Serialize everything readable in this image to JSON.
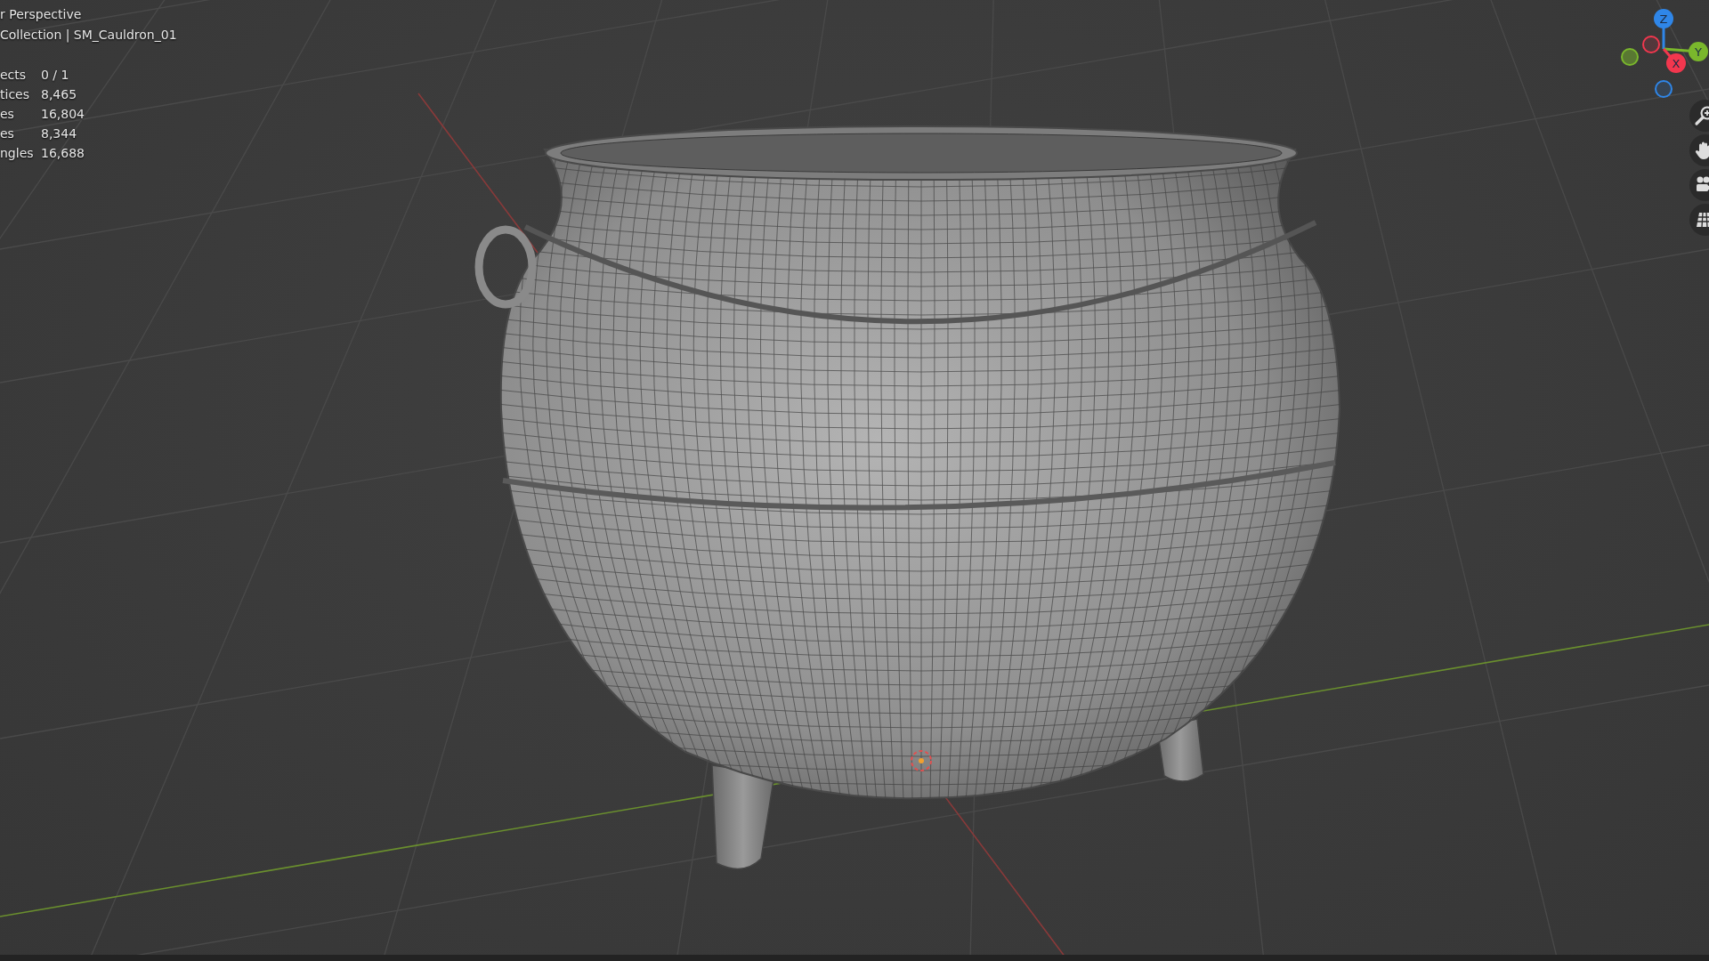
{
  "viewport": {
    "view_name": "r Perspective",
    "collection": "Collection | SM_Cauldron_01",
    "stats": [
      {
        "label": "ects",
        "value": "0 / 1"
      },
      {
        "label": "tices",
        "value": "8,465"
      },
      {
        "label": "es",
        "value": "16,804"
      },
      {
        "label": "es",
        "value": "8,344"
      },
      {
        "label": "ngles",
        "value": "16,688"
      }
    ]
  },
  "gizmo": {
    "axes": [
      {
        "label": "Z",
        "color": "#2f86e8"
      },
      {
        "label": "Y",
        "color": "#7ab72c"
      },
      {
        "label": "X",
        "color": "#f2374e"
      }
    ]
  }
}
